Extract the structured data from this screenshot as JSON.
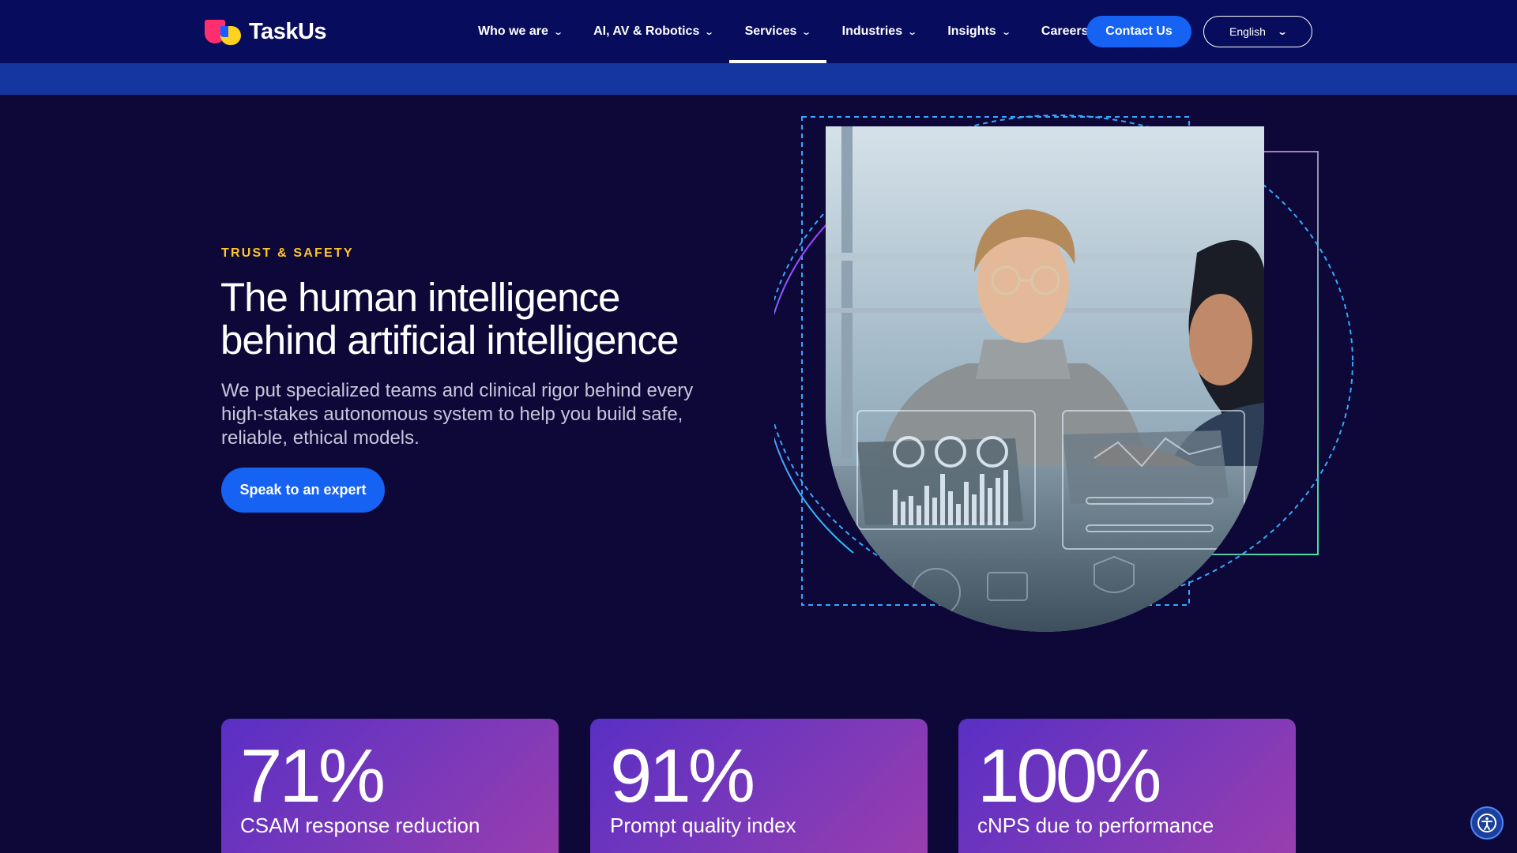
{
  "brand": {
    "name": "TaskUs"
  },
  "nav": {
    "items": [
      {
        "label": "Who we are",
        "has_dropdown": true,
        "active": false
      },
      {
        "label": "AI, AV & Robotics",
        "has_dropdown": true,
        "active": false
      },
      {
        "label": "Services",
        "has_dropdown": true,
        "active": true
      },
      {
        "label": "Industries",
        "has_dropdown": true,
        "active": false
      },
      {
        "label": "Insights",
        "has_dropdown": true,
        "active": false
      },
      {
        "label": "Careers",
        "has_dropdown": false,
        "active": false
      }
    ],
    "contact_label": "Contact Us",
    "language": "English"
  },
  "hero": {
    "eyebrow": "TRUST & SAFETY",
    "headline_line1": "The human intelligence",
    "headline_line2": "behind artificial intelligence",
    "subtext": "We put specialized teams and clinical rigor behind every high-stakes autonomous system to help you build safe, reliable, ethical models.",
    "cta_label": "Speak to an expert"
  },
  "stats": [
    {
      "value": "71%",
      "label": "CSAM response reduction"
    },
    {
      "value": "91%",
      "label": "Prompt quality index"
    },
    {
      "value": "100%",
      "label": "cNPS due to performance"
    }
  ],
  "colors": {
    "nav_bg": "#070c5c",
    "page_bg": "#0d0838",
    "accent_blue": "#1662f3",
    "eyebrow_yellow": "#ffc629",
    "card_gradient_start": "#5a2fc4",
    "card_gradient_end": "#9b3eae"
  },
  "icons": {
    "dropdown": "chevron-down-icon",
    "accessibility": "accessibility-icon"
  }
}
